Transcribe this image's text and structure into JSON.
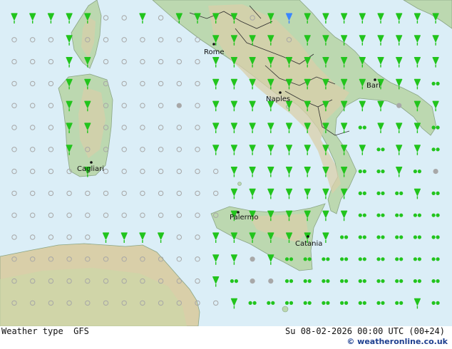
{
  "footer": {
    "left_label": "Weather type",
    "model": "GFS",
    "datetime": "Su 08-02-2026 00:00 UTC (00+24)",
    "credit": "© weatheronline.co.uk"
  },
  "cities": [
    {
      "name": "Rome",
      "key": "rome"
    },
    {
      "name": "Bari",
      "key": "bari"
    },
    {
      "name": "Naples",
      "key": "naples"
    },
    {
      "name": "Cagliari",
      "key": "cagliari"
    },
    {
      "name": "Palermo",
      "key": "palermo"
    },
    {
      "name": "Catania",
      "key": "catania"
    }
  ],
  "colors": {
    "sea": "#dbeef7",
    "land": "#bcd8b0",
    "mountain": "#d9cfa9",
    "rain": "#22c41d",
    "snow": "#3a86ff",
    "cloud": "#a8a8a8",
    "symbol_outline": "#a7a7a7"
  },
  "legend": {
    "o": "clear",
    "c": "cloudy",
    "d": "rain",
    "s": "showers",
    "t": "thunderstorms",
    "n": "snow"
  },
  "weather_grid": [
    "dddddoododdddodnddddddddd",
    "ooodoooooooddddodddddddd",
    "oooddooooooddddddddddddd",
    "oooddoooooodddddddddddds",
    "oooddoooocoddddddddddcdd",
    "oooddooooooddddddddsddds",
    "ooodooooooodddddddddsdds",
    "oooodooooooodddddddssdsc",
    "oooooooooooodddddddsssds",
    "oooooooooooodddddddssssst",
    "oooooddddoodddddddsssssss",
    "oooooooooooddcdsssssssss",
    "ooooooooooodsccssssssssst",
    "oooooooooooodsssssssssdst"
  ]
}
